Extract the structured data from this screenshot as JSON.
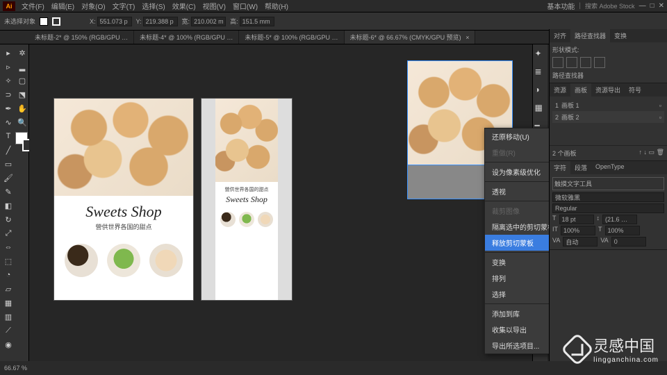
{
  "app": {
    "logo": "Ai",
    "workspace_label": "基本功能",
    "search": "搜索 Adobe Stock"
  },
  "menu": [
    "文件(F)",
    "编辑(E)",
    "对象(O)",
    "文字(T)",
    "选择(S)",
    "效果(C)",
    "视图(V)",
    "窗口(W)",
    "帮助(H)"
  ],
  "control": {
    "noSel": "未选择对象",
    "x": "551.073 p",
    "y": "219.388 p",
    "w": "210.002 m",
    "h": "151.5 mm"
  },
  "tabs": [
    {
      "label": "未标题-2* @ 150% (RGB/GPU …",
      "active": false
    },
    {
      "label": "未标题-4* @ 100% (RGB/GPU …",
      "active": false
    },
    {
      "label": "未标题-5* @ 100% (RGB/GPU …",
      "active": false
    },
    {
      "label": "未标题-6* @ 66.67% (CMYK/GPU 预览)",
      "active": true
    }
  ],
  "ab1": {
    "title": "Sweets Shop",
    "sub": "營供世界各国的甜点"
  },
  "ab2": {
    "sub": "營供世界各国的甜点",
    "title": "Sweets Shop"
  },
  "ctx": [
    {
      "t": "还原移动(U)",
      "k": "item"
    },
    {
      "t": "重做(R)",
      "k": "disabled"
    },
    {
      "t": "设为像素级优化",
      "k": "item"
    },
    {
      "t": "透视",
      "k": "sub"
    },
    {
      "t": "裁剪图像",
      "k": "disabled"
    },
    {
      "t": "隔离选中的剪切蒙板",
      "k": "item"
    },
    {
      "t": "释放剪切蒙板",
      "k": "hover"
    },
    {
      "t": "变换",
      "k": "sub"
    },
    {
      "t": "排列",
      "k": "sub"
    },
    {
      "t": "选择",
      "k": "sub"
    },
    {
      "t": "添加到库",
      "k": "item"
    },
    {
      "t": "收集以导出",
      "k": "sub"
    },
    {
      "t": "导出所选项目...",
      "k": "item"
    }
  ],
  "panels": {
    "p1": {
      "tabs": [
        "对齐",
        "路径查找器",
        "变换"
      ],
      "active": 1,
      "label": "形状模式:"
    },
    "p2": {
      "label": "路径查找器"
    },
    "artboards": {
      "tabs": [
        "资源",
        "画板",
        "资源导出",
        "符号"
      ],
      "active": 1,
      "rows": [
        {
          "n": "1",
          "name": "画板 1"
        },
        {
          "n": "2",
          "name": "画板 2"
        }
      ],
      "footer": "2 个画板"
    },
    "char": {
      "tabs": [
        "字符",
        "段落",
        "OpenType"
      ],
      "active": 0,
      "tool": "触摸文字工具",
      "font": "微软雅黑",
      "weight": "Regular",
      "size": "18 pt",
      "leading": "(21.6 …",
      "tracking": "100%",
      "kerning": "100%",
      "va1": "自动",
      "va2": "0"
    }
  },
  "status": {
    "zoom": "66.67 %"
  },
  "watermark": {
    "cn": "灵感中国",
    "en": "lingganchina.com"
  }
}
